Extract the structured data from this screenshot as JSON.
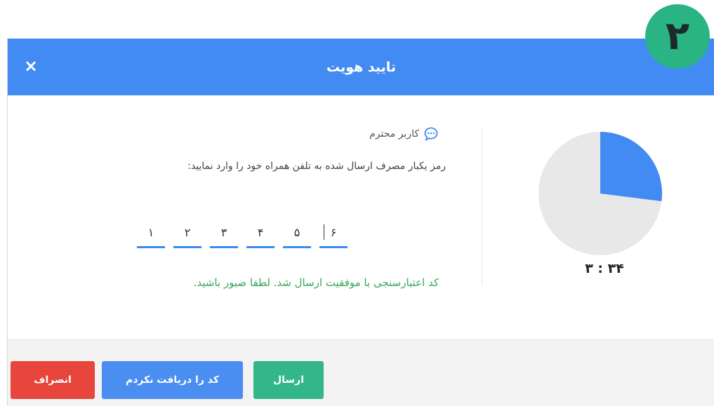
{
  "step_badge": "۲",
  "dialog": {
    "title": "تایید هویت",
    "close_label": "×"
  },
  "greeting": {
    "icon": "chat-bubble-icon",
    "text": "کاربر محترم"
  },
  "instruction": "رمز یکبار مصرف ارسال شده به تلفن همراه خود را وارد نمایید:",
  "otp_digits": [
    "۱",
    "۲",
    "۳",
    "۴",
    "۵",
    "۶"
  ],
  "success_message": "کد اعتبارسنجی با موفقیت ارسال شد. لطفا صبور باشید.",
  "countdown": {
    "timer_text": "۳ : ۳۴",
    "remaining_fraction": 0.27
  },
  "buttons": {
    "submit": "ارسال",
    "resend": "کد را دریافت نکردم",
    "cancel": "انصراف"
  },
  "colors": {
    "header": "#428bf3",
    "badge": "#2ab383",
    "pie_fill": "#428bf3",
    "pie_track": "#e8e8e8",
    "success_text": "#36a85a",
    "cancel": "#e8453c",
    "resend": "#4a8ef2",
    "submit": "#33b68a"
  }
}
